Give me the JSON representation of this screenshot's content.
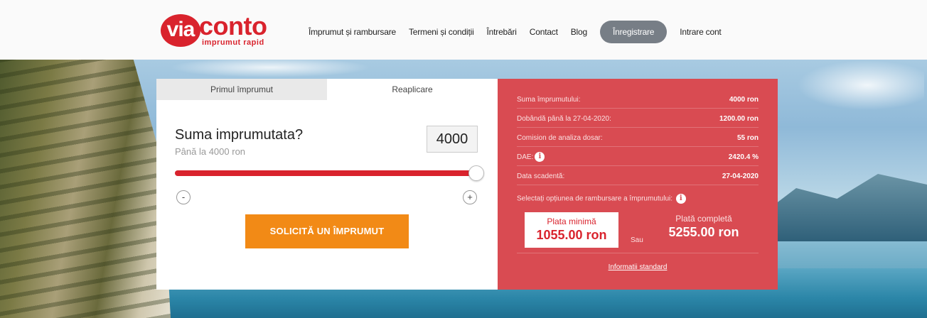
{
  "header": {
    "logo": {
      "main": "via",
      "word": "conto",
      "tagline": "imprumut rapid"
    },
    "nav": [
      {
        "label": "Împrumut și rambursare"
      },
      {
        "label": "Termeni și condiții"
      },
      {
        "label": "Întrebări"
      },
      {
        "label": "Contact"
      },
      {
        "label": "Blog"
      }
    ],
    "register_label": "Înregistrare",
    "login_label": "Intrare cont"
  },
  "calculator": {
    "tabs": [
      {
        "label": "Primul împrumut",
        "active": false
      },
      {
        "label": "Reaplicare",
        "active": true
      }
    ],
    "question": "Suma imprumutata?",
    "subtitle": "Până la 4000 ron",
    "amount_value": "4000",
    "slider": {
      "min": 0,
      "max": 4000,
      "value": 4000,
      "fraction": 1.0
    },
    "minus_label": "-",
    "plus_label": "+",
    "cta_label": "SOLICITĂ UN ÎMPRUMUT"
  },
  "summary": {
    "rows": [
      {
        "label": "Suma împrumutului:",
        "value": "4000 ron"
      },
      {
        "label": "Dobândă până la 27-04-2020:",
        "value": "1200.00 ron"
      },
      {
        "label": "Comision de analiza dosar:",
        "value": "55 ron"
      },
      {
        "label": "DAE:",
        "value": "2420.4 %"
      },
      {
        "label": "Data scadentă:",
        "value": "27-04-2020"
      }
    ],
    "option_label": "Selectați opțiunea de rambursare a împrumutului:",
    "min_payment": {
      "title": "Plata minimă",
      "value": "1055.00 ron"
    },
    "or_label": "Sau",
    "full_payment": {
      "title": "Plată completă",
      "value": "5255.00 ron"
    },
    "standard_info_label": "Informatii standard"
  },
  "colors": {
    "brand_red": "#d9232d",
    "summary_bg": "#d94b52",
    "cta_orange": "#f28a16",
    "register_grey": "#777e86"
  }
}
